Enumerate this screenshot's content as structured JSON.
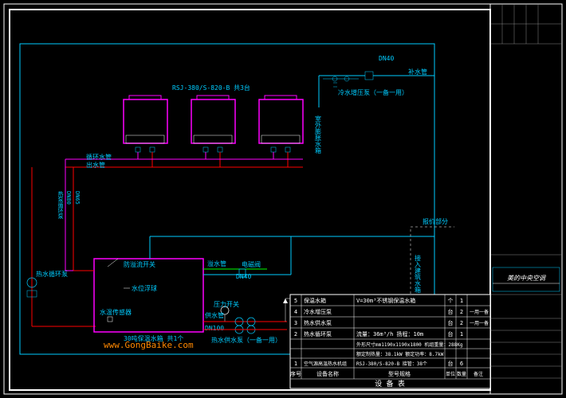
{
  "header_label": "RSJ-380/S-820-B  共3台",
  "dn40_label": "DN40",
  "supply_pipe": "补水管",
  "cold_pump": "冷水增压泵（一备一用）",
  "vert_right": "室外膨胀水箱",
  "hot_out_1": "循环水管",
  "hot_out_2": "出水管",
  "vert_left_1": "DN80",
  "vert_left_2": "热泵循环泵",
  "vert_left_3": "DN65",
  "hot_circ": "热水循环泵",
  "float_switch": "防溢流开关",
  "level": "水位浮球",
  "sensor": "水温传感器",
  "tank_label": "30吨保温水箱  共1个",
  "drain": "溢水管",
  "valve": "电磁阀",
  "dn40_2": "DN40",
  "pressure": "压力开关",
  "supply2": "供水管",
  "dn100": "DN100",
  "hot_pump": "热水供水泵（一备一用）",
  "quotation": "报价部分",
  "vert_far_right": "接入建筑水箱",
  "watermark": "www.GongBaike.com",
  "equipment_table_title": "设 备 表",
  "logo": "美的中央空调",
  "table": {
    "r5": {
      "no": "5",
      "name": "保温水箱",
      "spec": "V=30m³不锈钢保温水箱",
      "unit": "个",
      "qty": "1",
      "note": ""
    },
    "r4": {
      "no": "4",
      "name": "冷水增压泵",
      "spec": "",
      "unit": "台",
      "qty": "2",
      "note": "一用一备"
    },
    "r3": {
      "no": "3",
      "name": "热水供水泵",
      "spec": "",
      "unit": "台",
      "qty": "2",
      "note": "一用一备"
    },
    "r2": {
      "no": "2",
      "name": "热水循环泵",
      "spec": "流量：36m³/h 扬程：10m",
      "unit": "台",
      "qty": "1",
      "note": ""
    },
    "r1b": {
      "no": "",
      "name": "",
      "spec": "外形尺寸mm1190x1190x1800  机组重量：288Kg",
      "unit": "",
      "qty": "",
      "note": ""
    },
    "r1a": {
      "no": "",
      "name": "",
      "spec": "额定制热量：38.1kW  额定功率：8.7kW",
      "unit": "",
      "qty": "",
      "note": ""
    },
    "r1": {
      "no": "1",
      "name": "空气源高温热水机组",
      "spec": "RSJ-380/S-820-B  接管：38个",
      "unit": "台",
      "qty": "6",
      "note": ""
    },
    "rh": {
      "no": "序号",
      "name": "设备名称",
      "spec": "型号规格",
      "unit": "单位",
      "qty": "数量",
      "note": "备注"
    }
  }
}
